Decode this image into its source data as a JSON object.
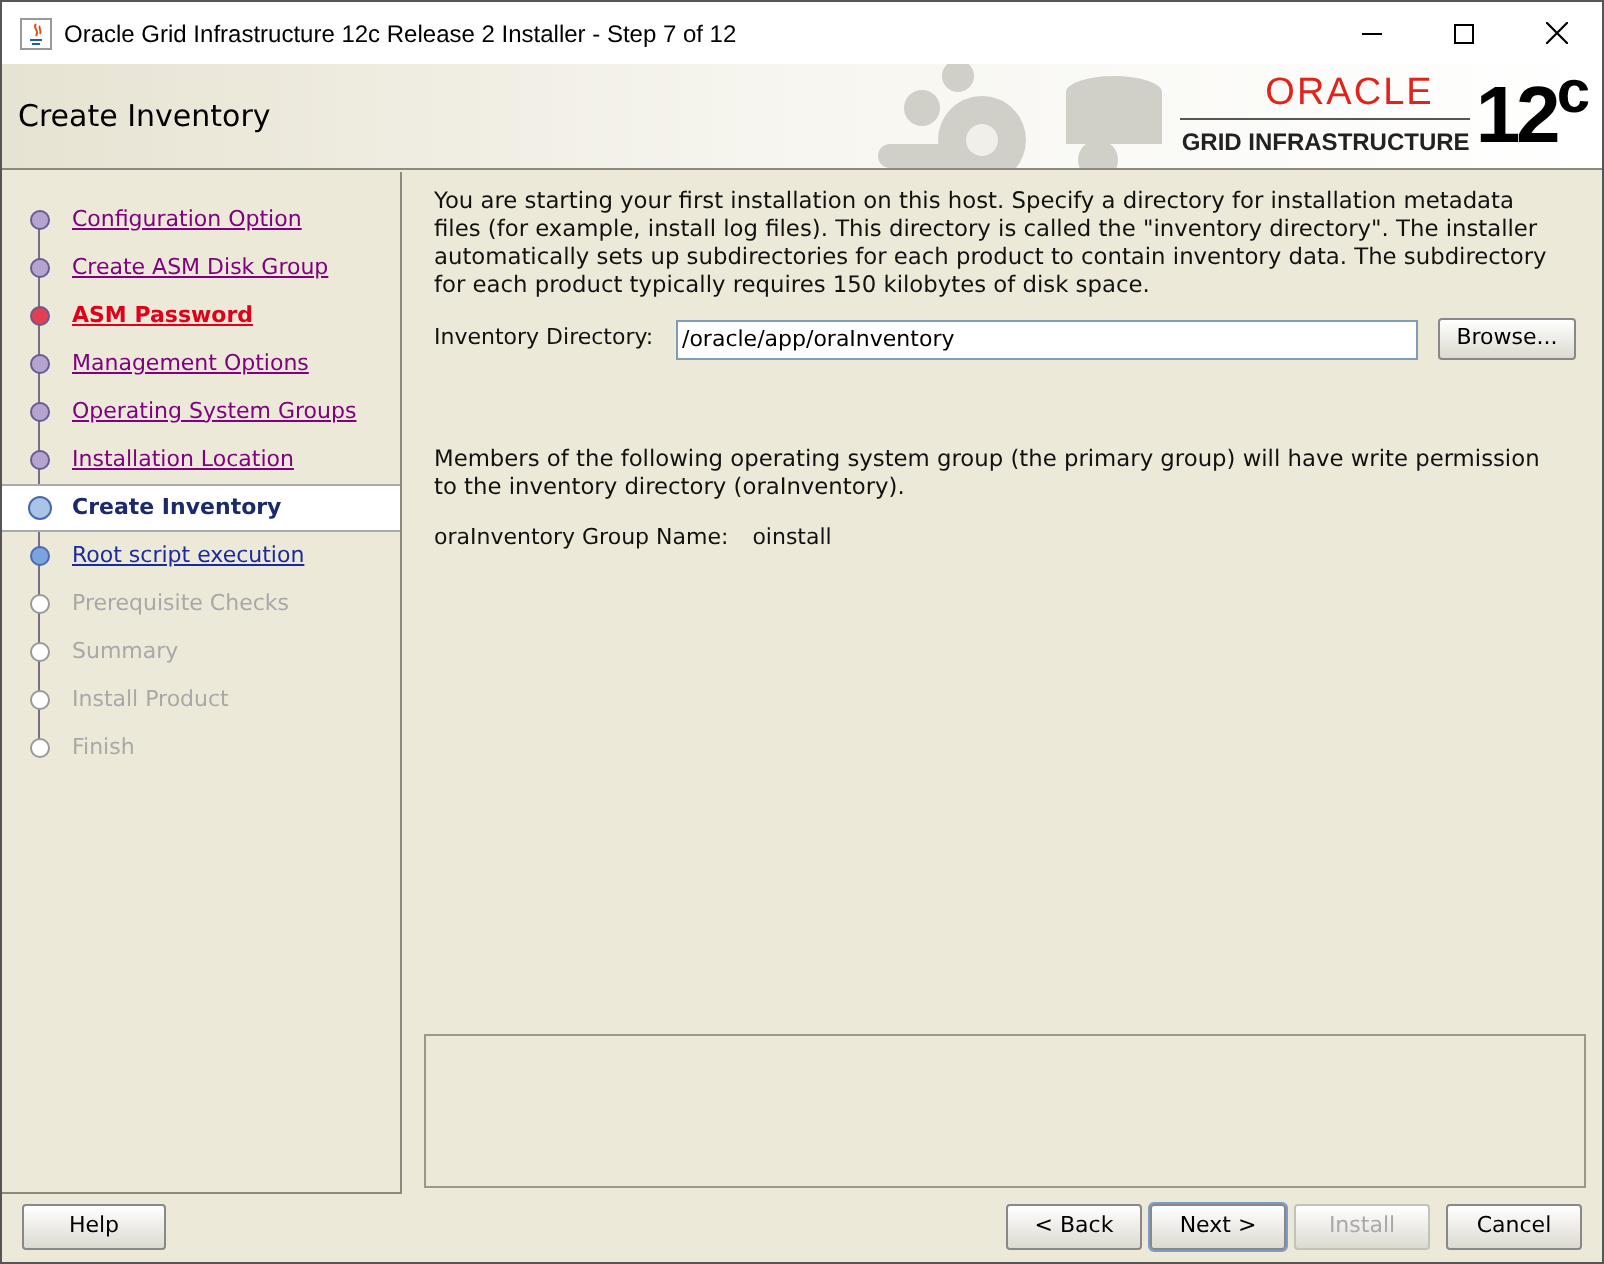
{
  "window": {
    "title": "Oracle Grid Infrastructure 12c Release 2 Installer - Step 7 of 12"
  },
  "header": {
    "title": "Create Inventory",
    "brand": "ORACLE",
    "product": "GRID INFRASTRUCTURE",
    "version": "12$^{c}$"
  },
  "steps": [
    {
      "label": "Configuration Option",
      "selected": false,
      "visited": true,
      "error": false,
      "disabled": false
    },
    {
      "label": "Create ASM Disk Group",
      "selected": false,
      "visited": true,
      "error": false,
      "disabled": false
    },
    {
      "label": "ASM Password",
      "selected": false,
      "visited": true,
      "error": true,
      "disabled": false
    },
    {
      "label": "Management Options",
      "selected": false,
      "visited": true,
      "error": false,
      "disabled": false
    },
    {
      "label": "Operating System Groups",
      "selected": false,
      "visited": true,
      "error": false,
      "disabled": false
    },
    {
      "label": "Installation Location",
      "selected": false,
      "visited": true,
      "error": false,
      "disabled": false
    },
    {
      "label": "Create Inventory",
      "selected": true,
      "visited": false,
      "error": false,
      "disabled": false
    },
    {
      "label": "Root script execution",
      "selected": false,
      "visited": false,
      "error": false,
      "disabled": false
    },
    {
      "label": "Prerequisite Checks",
      "selected": false,
      "visited": false,
      "error": false,
      "disabled": true
    },
    {
      "label": "Summary",
      "selected": false,
      "visited": false,
      "error": false,
      "disabled": true
    },
    {
      "label": "Install Product",
      "selected": false,
      "visited": false,
      "error": false,
      "disabled": true
    },
    {
      "label": "Finish",
      "selected": false,
      "visited": false,
      "error": false,
      "disabled": true
    }
  ],
  "content": {
    "intro": "You are starting your first installation on this host. Specify a directory for installation metadata files (for example, install log files). This directory is called the \"inventory directory\". The installer automatically sets up subdirectories for each product to contain inventory data. The subdirectory for each product typically requires 150 kilobytes of disk space.",
    "inventory_directory": {
      "label": "Inventory Directory:",
      "value": "/oracle/app/oraInventory"
    },
    "browse_button": {
      "label": "Browse..."
    },
    "group_note": "Members of the following operating system group (the primary group) will have write permission to the inventory directory (oraInventory).",
    "group_label": "oraInventory Group Name:",
    "group_value": "oinstall"
  },
  "buttons": [
    {
      "label": "Help",
      "disabled": false,
      "default": false
    },
    {
      "label": "< Back",
      "disabled": false,
      "default": false
    },
    {
      "label": "Next >",
      "disabled": false,
      "default": true
    },
    {
      "label": "Install",
      "disabled": true,
      "default": false
    },
    {
      "label": "Cancel",
      "disabled": false,
      "default": false
    }
  ]
}
